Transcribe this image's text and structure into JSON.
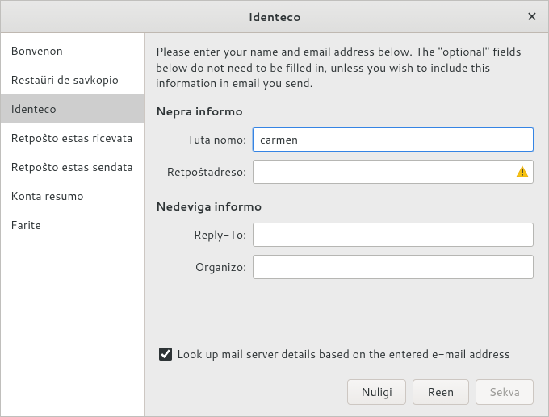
{
  "titlebar": {
    "title": "Identeco"
  },
  "sidebar": {
    "items": [
      {
        "label": "Bonvenon",
        "selected": false
      },
      {
        "label": "Restaŭri de savkopio",
        "selected": false
      },
      {
        "label": "Identeco",
        "selected": true
      },
      {
        "label": "Retpoŝto estas ricevata",
        "selected": false
      },
      {
        "label": "Retpoŝto estas sendata",
        "selected": false
      },
      {
        "label": "Konta resumo",
        "selected": false
      },
      {
        "label": "Farite",
        "selected": false
      }
    ]
  },
  "main": {
    "intro": "Please enter your name and email address below. The \"optional\" fields below do not need to be filled in, unless you wish to include this information in email you send.",
    "section_required_header": "Nepra informo",
    "section_optional_header": "Nedeviga informo",
    "fields": {
      "full_name": {
        "label": "Tuta nomo:",
        "value": "carmen"
      },
      "email": {
        "label": "Retpoŝtadreso:",
        "value": "",
        "has_warning": true
      },
      "reply_to": {
        "label": "Reply-To:",
        "value": ""
      },
      "organization": {
        "label": "Organizo:",
        "value": ""
      }
    },
    "lookup": {
      "checked": true,
      "label": "Look up mail server details based on the entered e-mail address"
    },
    "buttons": {
      "cancel": "Nuligi",
      "back": "Reen",
      "next": "Sekva",
      "next_enabled": false
    }
  }
}
